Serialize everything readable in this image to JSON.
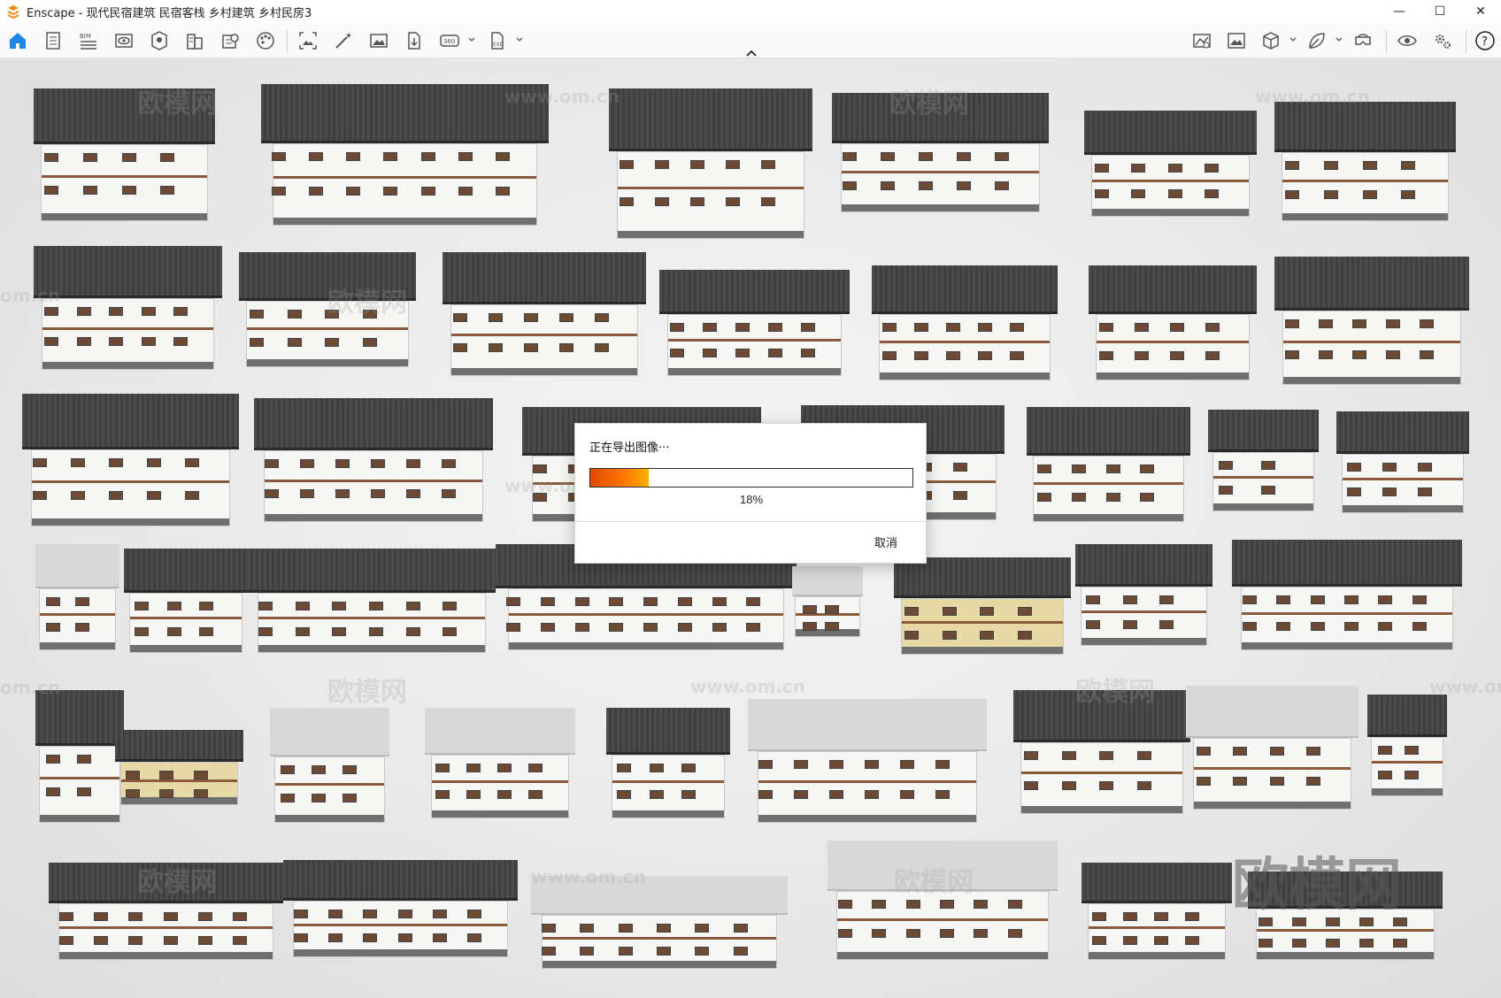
{
  "window": {
    "title": "Enscape - 现代民宿建筑 民宿客栈 乡村建筑 乡村民房3",
    "minimize": "—",
    "maximize": "☐",
    "close": "✕",
    "brand_color": "#f28a1a"
  },
  "toolbar": {
    "accent_color": "#1e88e5",
    "left_icons": [
      "home-icon",
      "document-icon",
      "bim-icon",
      "view-eye-icon",
      "asset-library-icon",
      "building-icon",
      "site-context-icon",
      "materials-palette-icon",
      "screenshot-icon",
      "magic-wand-icon",
      "image-icon",
      "export-file-icon",
      "panorama-360-icon",
      "exe-export-icon"
    ],
    "right_icons": [
      "compare-image-icon",
      "gallery-icon",
      "cube-view-icon",
      "leaf-icon",
      "vr-headset-icon",
      "visibility-eye-icon",
      "settings-gears-icon",
      "help-icon"
    ],
    "bim_label": "BIM",
    "pano_label": "360",
    "exe_label": "EXE",
    "help_label": "?"
  },
  "viewport": {
    "watermark_text": "欧模网",
    "watermark_url": "www.om.cn",
    "watermark_partial": "om.cn",
    "big_watermark": "欧模网"
  },
  "export_dialog": {
    "title": "正在导出图像···",
    "progress_percent": 18,
    "progress_label": "18%",
    "cancel_label": "取消"
  }
}
